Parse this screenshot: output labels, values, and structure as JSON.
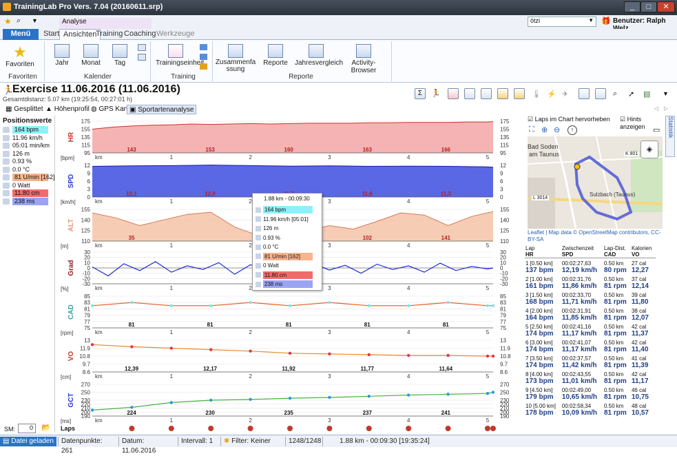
{
  "window": {
    "title": "TrainingLab Pro Vers. 7.04 (20160611.srp)"
  },
  "ribbon": {
    "context_group": "Analyse",
    "menu_label": "Menü",
    "tabs": [
      "Start",
      "Ansichten",
      "Training",
      "Coaching",
      "Werkzeuge"
    ],
    "groups": {
      "favoriten": {
        "label": "Favoriten",
        "items": [
          "Favoriten"
        ]
      },
      "kalender": {
        "label": "Kalender",
        "items": [
          "Jahr",
          "Monat",
          "Tag"
        ]
      },
      "training": {
        "label": "Training",
        "items": [
          "Trainingseinheit"
        ]
      },
      "reporte": {
        "label": "Reporte",
        "items": [
          "Zusammenfassung",
          "Reporte",
          "Jahresvergleich",
          "Activity-Browser"
        ]
      }
    },
    "user_select": "ötzi",
    "user_label": "Benutzer: Ralph Welz"
  },
  "exercise": {
    "title": "Exercise 11.06.2016 (11.06.2016)",
    "subtitle": "Gesamtdistanz: 5.07 km (19:25:54, 00:27:01 h)"
  },
  "subtabs": [
    "Gesplittet",
    "Höhenprofil",
    "GPS Karte",
    "Sportartenanalyse"
  ],
  "positionswerte": {
    "title": "Positionswerte",
    "items": [
      {
        "text": "164 bpm",
        "color": "#8ef0f8",
        "icon": "heart-icon"
      },
      {
        "text": "11.96 km/h",
        "color": "",
        "icon": "speedometer-icon"
      },
      {
        "text": "05:01 min/km",
        "color": "",
        "icon": "runner-icon"
      },
      {
        "text": "126 m",
        "color": "",
        "icon": "altitude-icon"
      },
      {
        "text": "0.93 %",
        "color": "",
        "icon": "gradient-icon"
      },
      {
        "text": "0.0 °C",
        "color": "",
        "icon": "thermometer-icon"
      },
      {
        "text": "81 U/min [162]",
        "color": "#f7b48e",
        "icon": "cadence-icon"
      },
      {
        "text": "0 Watt",
        "color": "",
        "icon": "power-icon"
      },
      {
        "text": "11.80 cm",
        "color": "#f26b6b",
        "icon": "vertical-oscillation-icon"
      },
      {
        "text": "238 ms",
        "color": "#9aa4f2",
        "icon": "ground-contact-icon"
      }
    ],
    "sm_label": "SM:",
    "sm_value": "0"
  },
  "tooltip": {
    "header": "1.88 km - 00:09:30",
    "rows": [
      {
        "text": "164 bpm",
        "color": "#8ef0f8"
      },
      {
        "text": "11.96 km/h [05:01]",
        "color": ""
      },
      {
        "text": "126 m",
        "color": ""
      },
      {
        "text": "0.93 %",
        "color": ""
      },
      {
        "text": "0.0 °C",
        "color": ""
      },
      {
        "text": "81 U/min [162]",
        "color": "#f7b48e"
      },
      {
        "text": "0 Watt",
        "color": ""
      },
      {
        "text": "11.80 cm",
        "color": "#f26b6b"
      },
      {
        "text": "238 ms",
        "color": "#9aa4f2"
      }
    ]
  },
  "chart_data": [
    {
      "type": "area",
      "name": "HR",
      "unit": "[bpm]",
      "ylim": [
        95,
        175
      ],
      "yticks": [
        95,
        115,
        135,
        155,
        175
      ],
      "color": "#f4a6a6",
      "line": "#c0392b",
      "x": [
        0,
        0.25,
        0.5,
        0.75,
        1,
        1.25,
        1.5,
        1.75,
        2,
        2.25,
        2.5,
        2.75,
        3,
        3.25,
        3.5,
        3.75,
        4,
        4.25,
        4.5,
        4.75,
        5,
        5.07
      ],
      "y": [
        155,
        160,
        163,
        165,
        166,
        168,
        167,
        168,
        169,
        168,
        169,
        170,
        170,
        170,
        171,
        171,
        172,
        172,
        172,
        173,
        173,
        174
      ],
      "labels": [
        "143",
        "153",
        "160",
        "163",
        "166"
      ]
    },
    {
      "type": "area",
      "name": "SPD",
      "unit": "[km/h]",
      "ylim": [
        0,
        12
      ],
      "yticks": [
        0,
        3,
        6,
        9,
        12
      ],
      "color": "#3d4ee0",
      "line": "#1a1aa0",
      "x": [
        0,
        0.5,
        1,
        1.5,
        2,
        2.5,
        3,
        3.5,
        4,
        4.5,
        5,
        5.07
      ],
      "y": [
        11.6,
        11.8,
        11.9,
        12.1,
        11.9,
        11.7,
        11.8,
        11.6,
        11.7,
        11.6,
        11.4,
        11.3
      ],
      "labels": [
        "12,1",
        "12,0",
        "11,7",
        "11,6",
        "11,3"
      ]
    },
    {
      "type": "area",
      "name": "ALT",
      "unit": "[m]",
      "ylim": [
        110,
        155
      ],
      "yticks": [
        110,
        125,
        140,
        155
      ],
      "color": "#f6c3a8",
      "line": "#d37a57",
      "x": [
        0,
        0.3,
        0.6,
        0.9,
        1.2,
        1.5,
        1.8,
        2.1,
        2.4,
        2.7,
        3.0,
        3.3,
        3.6,
        3.9,
        4.2,
        4.5,
        4.8,
        5.07
      ],
      "y": [
        150,
        143,
        132,
        140,
        148,
        151,
        130,
        118,
        128,
        124,
        132,
        127,
        138,
        150,
        147,
        132,
        145,
        152
      ],
      "labels": [
        "35",
        "",
        "90",
        "102",
        "141"
      ]
    },
    {
      "type": "line",
      "name": "Grad",
      "unit": "[%]",
      "ylim": [
        -30,
        30
      ],
      "yticks": [
        -30,
        -20,
        -10,
        0,
        10,
        20,
        30
      ],
      "color": "#1d2ad6",
      "line": "#1d2ad6",
      "x": [
        0,
        0.2,
        0.4,
        0.6,
        0.8,
        1,
        1.2,
        1.4,
        1.6,
        1.8,
        2,
        2.2,
        2.4,
        2.6,
        2.8,
        3,
        3.2,
        3.4,
        3.6,
        3.8,
        4,
        4.2,
        4.4,
        4.6,
        4.8,
        5,
        5.07
      ],
      "y": [
        2,
        -15,
        8,
        -5,
        12,
        -8,
        4,
        -3,
        10,
        -12,
        6,
        -2,
        3,
        -6,
        8,
        -4,
        5,
        -10,
        7,
        -3,
        4,
        -8,
        9,
        -5,
        3,
        -2,
        0
      ],
      "labels": []
    },
    {
      "type": "scatter",
      "name": "CAD",
      "unit": "[rpm]",
      "ylim": [
        75,
        85
      ],
      "yticks": [
        75,
        77,
        79,
        81,
        83,
        85
      ],
      "color": "#7ee6ea",
      "line": "#e35a1b",
      "x": [
        0,
        0.5,
        1,
        1.5,
        2,
        2.5,
        3,
        3.5,
        4,
        4.5,
        5,
        5.07
      ],
      "y": [
        82,
        83,
        82,
        82,
        83,
        82,
        83,
        82,
        82,
        83,
        82,
        82
      ],
      "labels": [
        "81",
        "81",
        "81",
        "81",
        "81"
      ]
    },
    {
      "type": "scatter",
      "name": "VO",
      "unit": "[cm]",
      "ylim": [
        8.6,
        13.0
      ],
      "yticks": [
        8.6,
        9.7,
        10.8,
        11.9,
        13.0
      ],
      "color": "#e8324a",
      "line": "#e88a2a",
      "x": [
        0,
        0.5,
        1,
        1.5,
        2,
        2.5,
        3,
        3.5,
        4,
        4.5,
        5,
        5.07
      ],
      "y": [
        12.4,
        12.1,
        11.9,
        11.7,
        11.5,
        11.2,
        11.1,
        11.0,
        10.9,
        10.9,
        10.8,
        10.8
      ],
      "labels": [
        "12,39",
        "12,17",
        "11,92",
        "11,77",
        "11,64"
      ]
    },
    {
      "type": "scatter",
      "name": "GCT",
      "unit": "[ms]",
      "ylim": [
        190,
        270
      ],
      "yticks": [
        190,
        200,
        210,
        220,
        230,
        250,
        270
      ],
      "color": "#1f9fd8",
      "line": "#4bb03f",
      "x": [
        0,
        0.5,
        1,
        1.5,
        2,
        2.5,
        3,
        3.5,
        4,
        4.5,
        5,
        5.07
      ],
      "y": [
        205,
        212,
        224,
        230,
        232,
        235,
        237,
        240,
        243,
        245,
        247,
        250
      ],
      "labels": [
        "224",
        "230",
        "235",
        "237",
        "241"
      ]
    }
  ],
  "xaxis": {
    "unit": "km",
    "ticks": [
      "1",
      "2",
      "3",
      "4",
      "5"
    ]
  },
  "laps": {
    "label": "Laps",
    "count": 11
  },
  "map": {
    "checkbox_laps": "Laps im Chart hervorheben",
    "checkbox_hints": "Hints anzeigen",
    "attribution": "Leaflet | Map data © OpenStreetMap contributors, CC-BY-SA",
    "place1": "Bad Soden",
    "place2": "am Taunus",
    "place3": "Sulzbach (Taunus)",
    "road1": "L 3014",
    "road2": "K 801"
  },
  "lap_table": {
    "headers": [
      [
        "Lap",
        "HR"
      ],
      [
        "Zwischenzeit",
        "SPD"
      ],
      [
        "Lap-Dist.",
        "CAD"
      ],
      [
        "Kalorien",
        "VO"
      ]
    ],
    "rows": [
      {
        "a": "1 [0.50 km]",
        "b": "137 bpm",
        "c": "00:02:27,63",
        "d": "12,19 km/h",
        "e": "0.50 km",
        "f": "80 rpm",
        "g": "27 cal",
        "h": "12,27"
      },
      {
        "a": "2 [1.00 km]",
        "b": "161 bpm",
        "c": "00:02:31,76",
        "d": "11,86 km/h",
        "e": "0.50 km",
        "f": "81 rpm",
        "g": "37 cal",
        "h": "12,14"
      },
      {
        "a": "3 [1.50 km]",
        "b": "168 bpm",
        "c": "00:02:33,70",
        "d": "11,71 km/h",
        "e": "0.50 km",
        "f": "81 rpm",
        "g": "39 cal",
        "h": "11,80"
      },
      {
        "a": "4 [2.00 km]",
        "b": "164 bpm",
        "c": "00:02:31,91",
        "d": "11,85 km/h",
        "e": "0.50 km",
        "f": "81 rpm",
        "g": "38 cal",
        "h": "12,07"
      },
      {
        "a": "5 [2.50 km]",
        "b": "174 bpm",
        "c": "00:02:41,16",
        "d": "11,17 km/h",
        "e": "0.50 km",
        "f": "81 rpm",
        "g": "42 cal",
        "h": "11,37"
      },
      {
        "a": "6 [3.00 km]",
        "b": "174 bpm",
        "c": "00:02:41,07",
        "d": "11,17 km/h",
        "e": "0.50 km",
        "f": "81 rpm",
        "g": "42 cal",
        "h": "11,40"
      },
      {
        "a": "7 [3.50 km]",
        "b": "174 bpm",
        "c": "00:02:37,57",
        "d": "11,42 km/h",
        "e": "0.50 km",
        "f": "81 rpm",
        "g": "41 cal",
        "h": "11,39"
      },
      {
        "a": "8 [4.00 km]",
        "b": "173 bpm",
        "c": "00:02:43,55",
        "d": "11,01 km/h",
        "e": "0.50 km",
        "f": "81 rpm",
        "g": "42 cal",
        "h": "11,17"
      },
      {
        "a": "9 [4.50 km]",
        "b": "179 bpm",
        "c": "00:02:49,00",
        "d": "10,65 km/h",
        "e": "0.50 km",
        "f": "81 rpm",
        "g": "46 cal",
        "h": "10,75"
      },
      {
        "a": "10 [5.00 km]",
        "b": "178 bpm",
        "c": "00:02:58,34",
        "d": "10,09 km/h",
        "e": "0.50 km",
        "f": "81 rpm",
        "g": "48 cal",
        "h": "10,57"
      }
    ]
  },
  "statusbar": {
    "loaded": "Datei geladen",
    "points": "Datenpunkte: 261",
    "date": "Datum: 11.06.2016",
    "interval": "Intervall: 1",
    "filter": "Filter: Keiner",
    "count": "1248/1248",
    "position": "1.88 km - 00:09:30 [19:35:24]"
  },
  "side_tab": "Statistik"
}
